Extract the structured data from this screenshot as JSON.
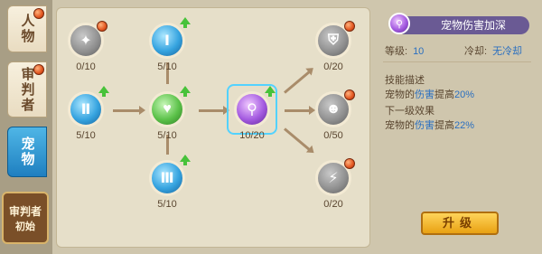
{
  "tabs": [
    {
      "label": "人物",
      "active": false,
      "badge": true
    },
    {
      "label": "审判者",
      "active": false,
      "badge": true
    },
    {
      "label": "宠物",
      "active": true,
      "badge": false
    }
  ],
  "init_badge": {
    "line1": "审判者",
    "line2": "初始"
  },
  "tree": {
    "nodes": [
      {
        "id": "n1",
        "level": "0/10",
        "color": "gray",
        "glyph": "✦",
        "badge": true,
        "upgrade": false
      },
      {
        "id": "n2",
        "level": "5/10",
        "color": "blue",
        "glyph": "Ⅰ",
        "badge": false,
        "upgrade": true
      },
      {
        "id": "n3",
        "level": "5/10",
        "color": "blue",
        "glyph": "Ⅱ",
        "badge": false,
        "upgrade": true
      },
      {
        "id": "n4",
        "level": "5/10",
        "color": "green",
        "glyph": "♥",
        "badge": false,
        "upgrade": true
      },
      {
        "id": "n5",
        "level": "5/10",
        "color": "blue",
        "glyph": "Ⅲ",
        "badge": false,
        "upgrade": true
      },
      {
        "id": "n6",
        "level": "10/20",
        "color": "purple",
        "glyph": "⚲",
        "badge": false,
        "upgrade": true
      },
      {
        "id": "n7",
        "level": "0/20",
        "color": "gray",
        "glyph": "⛨",
        "badge": true,
        "upgrade": false
      },
      {
        "id": "n8",
        "level": "0/50",
        "color": "gray",
        "glyph": "☻",
        "badge": true,
        "upgrade": false
      },
      {
        "id": "n9",
        "level": "0/20",
        "color": "gray",
        "glyph": "⚡",
        "badge": true,
        "upgrade": false
      }
    ]
  },
  "info": {
    "title": "宠物伤害加深",
    "level_label": "等级:",
    "level_value": "10",
    "cooldown_label": "冷却:",
    "cooldown_value": "无冷却",
    "skill_desc_title": "技能描述",
    "skill_desc_text_a": "宠物的",
    "skill_desc_hl": "伤害",
    "skill_desc_text_b": "提高",
    "skill_desc_val": "20%",
    "next_title": "下一级效果",
    "next_text_a": "宠物的",
    "next_hl": "伤害",
    "next_text_b": "提高",
    "next_val": "22%",
    "upgrade_button": "升级"
  }
}
